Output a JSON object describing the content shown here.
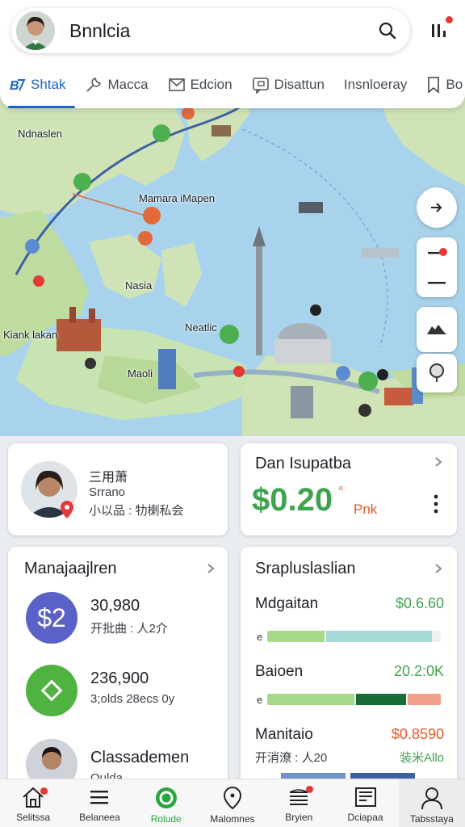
{
  "search": {
    "title": "Bnnlcia"
  },
  "tabs": [
    {
      "label": "Shtak",
      "icon": "bs-logo-icon"
    },
    {
      "label": "Macca",
      "icon": "wrench-icon"
    },
    {
      "label": "Edcion",
      "icon": "mail-icon"
    },
    {
      "label": "Disattun",
      "icon": "message-icon"
    },
    {
      "label": "Insnloeray",
      "icon": ""
    },
    {
      "label": "Bo",
      "icon": "bookmark-icon"
    }
  ],
  "map": {
    "labels": {
      "nw": "Ndnaslen",
      "route": "Mamara iMapen",
      "center": "Nasia",
      "west": "Kiank lakan",
      "east": "Neatlic",
      "south": "Maoli"
    }
  },
  "profile_card": {
    "name": "三用萧",
    "role": "Srrano",
    "detail": "小以品 : 牞楋私会"
  },
  "balance_card": {
    "title": "Dan Isupatba",
    "amount": "$0.20",
    "superscript": "º",
    "suffix": "Pnk"
  },
  "manage_card": {
    "title": "Manajaajlren",
    "items": [
      {
        "icon_text": "$2",
        "value": "30,980",
        "sub": "开批曲 : 人2介"
      },
      {
        "icon_text": "",
        "value": "236,900",
        "sub": "3;olds 28ecs 0y"
      },
      {
        "icon_text": "",
        "value": "Classademen",
        "sub": "Oulda"
      }
    ]
  },
  "stats_card": {
    "title": "Srapluslaslian",
    "rows": [
      {
        "name": "Mdgaitan",
        "value": "$0.6.60",
        "value_color": "#3fa34d",
        "bar_prefix": "e",
        "bar_fraction": 0.95
      },
      {
        "name": "Baioen",
        "value": "20.2:0K",
        "value_color": "#3fa34d",
        "bar_prefix": "e",
        "bar_fraction": 1.0
      },
      {
        "name": "Manitaio",
        "value": "$0.8590",
        "value_color": "#e05a2b",
        "bar_prefix": "",
        "bar_fraction": 0.0,
        "sub": "开消潦 : 人20",
        "sub_right": "装米Allo"
      }
    ]
  },
  "bottom_nav": [
    {
      "label": "Selitssa",
      "icon": "home-icon"
    },
    {
      "label": "Belaneea",
      "icon": "menu-icon"
    },
    {
      "label": "Rolude",
      "icon": "circle-check-icon"
    },
    {
      "label": "Malomnes",
      "icon": "location-icon"
    },
    {
      "label": "Bryien",
      "icon": "layers-icon"
    },
    {
      "label": "Dciapaa",
      "icon": "document-icon"
    },
    {
      "label": "Tabsstaya",
      "icon": "person-icon"
    }
  ],
  "colors": {
    "accent_blue": "#1e63c7",
    "green": "#3fa34d",
    "red": "#e53935",
    "ocean": "#a9d3ec",
    "land": "#c9e4b3"
  }
}
